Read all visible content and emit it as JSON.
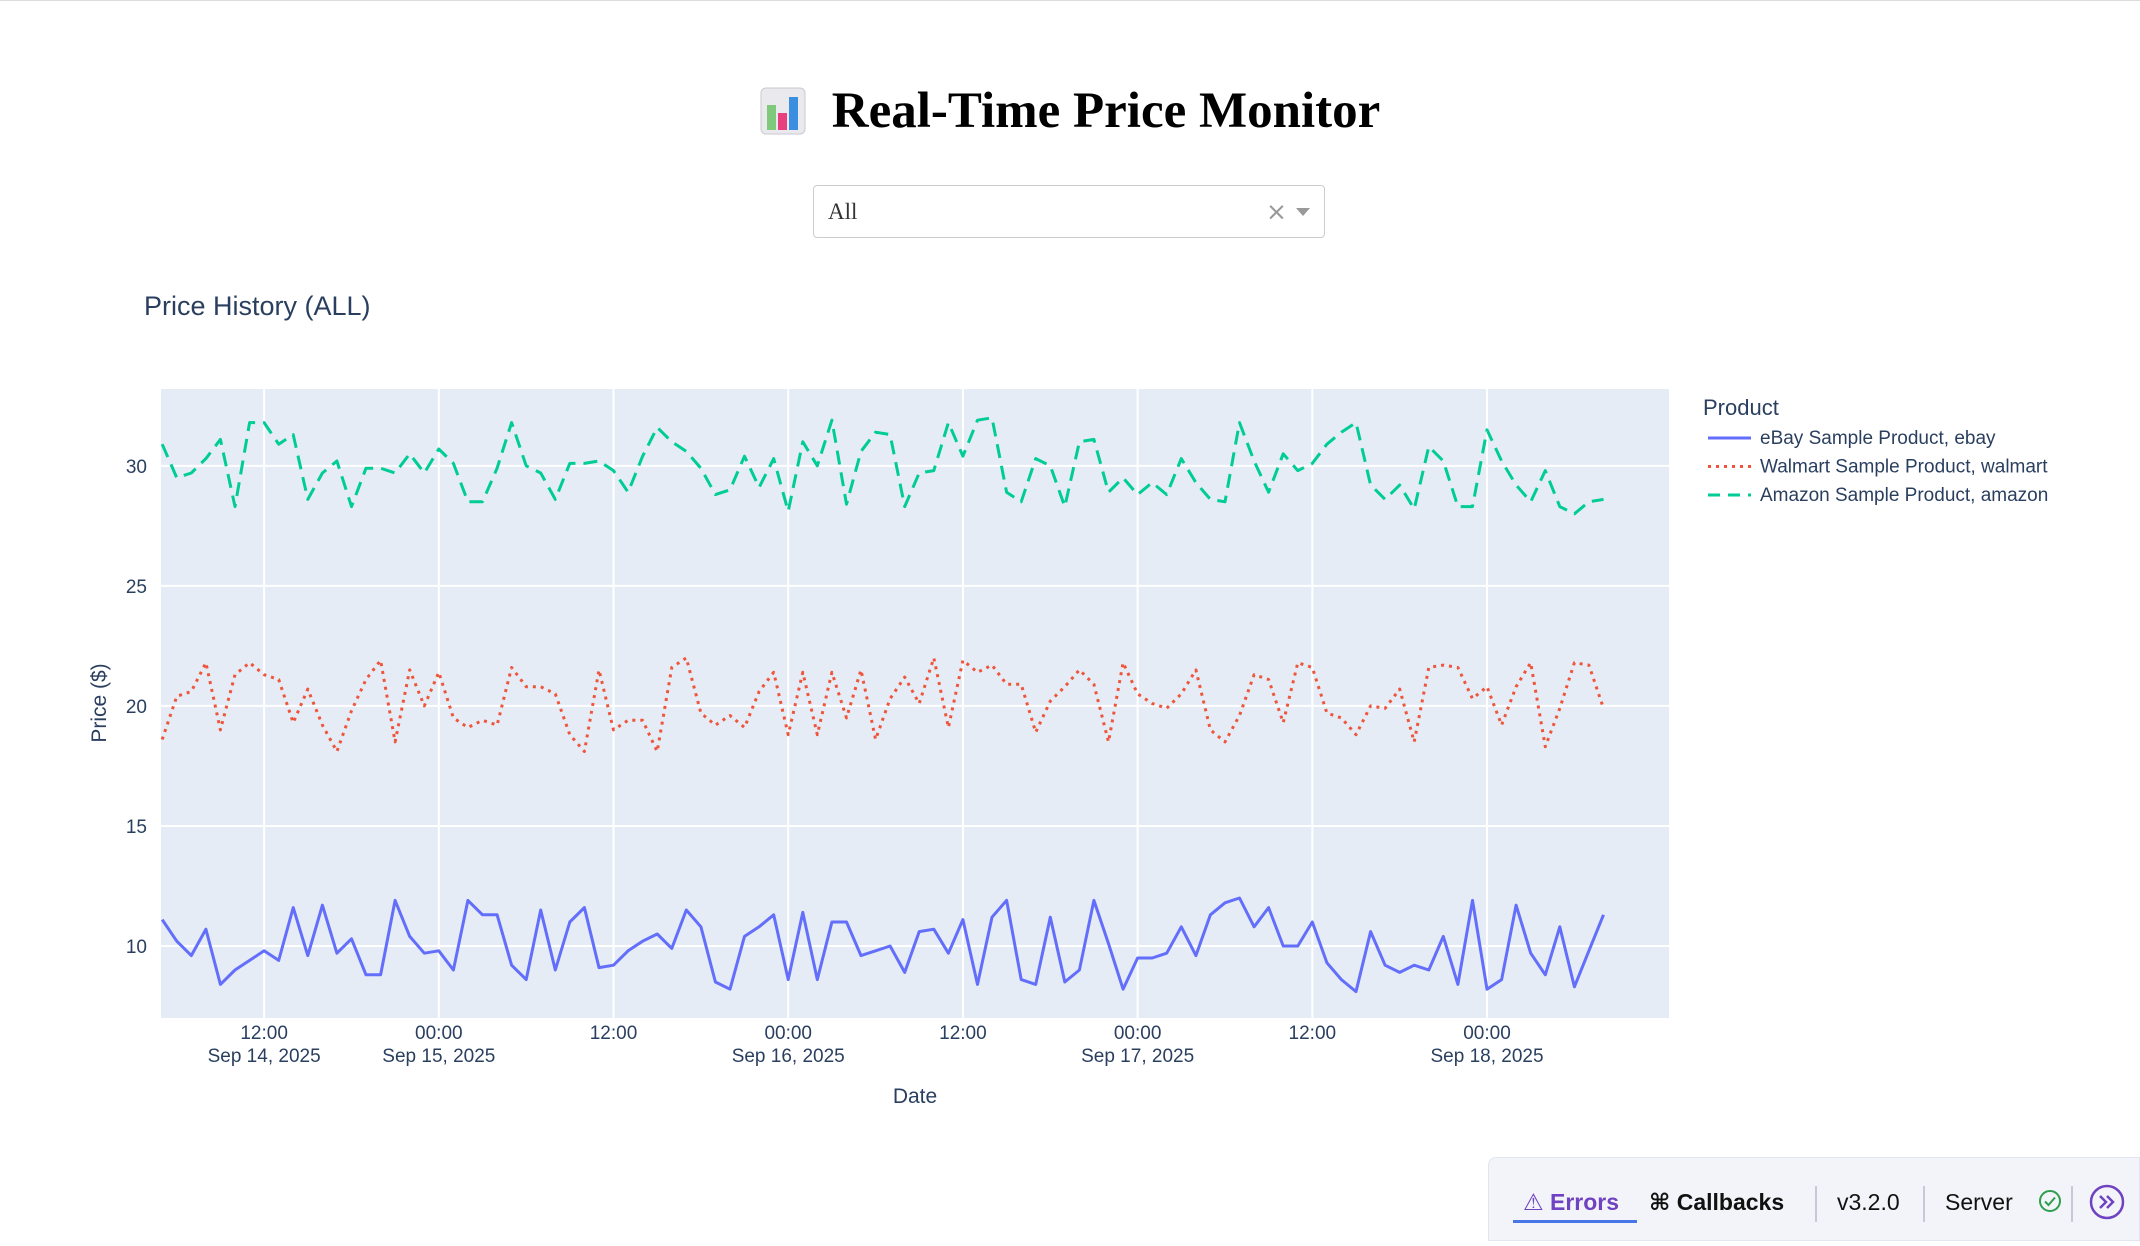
{
  "header": {
    "title": "Real-Time Price Monitor",
    "icon": "bar-chart-emoji-icon"
  },
  "filter": {
    "selected": "All",
    "clear_glyph": "×"
  },
  "devtools": {
    "errors_label": "Errors",
    "callbacks_label": "Callbacks",
    "version": "v3.2.0",
    "server_label": "Server",
    "accent": "#6f42c1"
  },
  "chart_data": {
    "type": "line",
    "title": "Price History (ALL)",
    "xlabel": "Date",
    "ylabel": "Price ($)",
    "legend_title": "Product",
    "legend_position": "right",
    "grid": true,
    "background": "#e5ecf6",
    "x_range": [
      "2025-09-14 04:55",
      "2025-09-18 12:30"
    ],
    "ylim": [
      7,
      33.2
    ],
    "yticks": [
      10,
      15,
      20,
      25,
      30
    ],
    "xticks": [
      {
        "at": "2025-09-14 12:00",
        "line1": "12:00",
        "line2": "Sep 14, 2025"
      },
      {
        "at": "2025-09-15 00:00",
        "line1": "00:00",
        "line2": "Sep 15, 2025"
      },
      {
        "at": "2025-09-15 12:00",
        "line1": "12:00",
        "line2": ""
      },
      {
        "at": "2025-09-16 00:00",
        "line1": "00:00",
        "line2": "Sep 16, 2025"
      },
      {
        "at": "2025-09-16 12:00",
        "line1": "12:00",
        "line2": ""
      },
      {
        "at": "2025-09-17 00:00",
        "line1": "00:00",
        "line2": "Sep 17, 2025"
      },
      {
        "at": "2025-09-17 12:00",
        "line1": "12:00",
        "line2": ""
      },
      {
        "at": "2025-09-18 00:00",
        "line1": "00:00",
        "line2": "Sep 18, 2025"
      }
    ],
    "x": [
      "2025-09-14 05:00",
      "2025-09-14 06:00",
      "2025-09-14 07:00",
      "2025-09-14 08:00",
      "2025-09-14 09:00",
      "2025-09-14 10:00",
      "2025-09-14 11:00",
      "2025-09-14 12:00",
      "2025-09-14 13:00",
      "2025-09-14 14:00",
      "2025-09-14 15:00",
      "2025-09-14 16:00",
      "2025-09-14 17:00",
      "2025-09-14 18:00",
      "2025-09-14 19:00",
      "2025-09-14 20:00",
      "2025-09-14 21:00",
      "2025-09-14 22:00",
      "2025-09-14 23:00",
      "2025-09-15 00:00",
      "2025-09-15 01:00",
      "2025-09-15 02:00",
      "2025-09-15 03:00",
      "2025-09-15 04:00",
      "2025-09-15 05:00",
      "2025-09-15 06:00",
      "2025-09-15 07:00",
      "2025-09-15 08:00",
      "2025-09-15 09:00",
      "2025-09-15 10:00",
      "2025-09-15 11:00",
      "2025-09-15 12:00",
      "2025-09-15 13:00",
      "2025-09-15 14:00",
      "2025-09-15 15:00",
      "2025-09-15 16:00",
      "2025-09-15 17:00",
      "2025-09-15 18:00",
      "2025-09-15 19:00",
      "2025-09-15 20:00",
      "2025-09-15 21:00",
      "2025-09-15 22:00",
      "2025-09-15 23:00",
      "2025-09-16 00:00",
      "2025-09-16 01:00",
      "2025-09-16 02:00",
      "2025-09-16 03:00",
      "2025-09-16 04:00",
      "2025-09-16 05:00",
      "2025-09-16 06:00",
      "2025-09-16 07:00",
      "2025-09-16 08:00",
      "2025-09-16 09:00",
      "2025-09-16 10:00",
      "2025-09-16 11:00",
      "2025-09-16 12:00",
      "2025-09-16 13:00",
      "2025-09-16 14:00",
      "2025-09-16 15:00",
      "2025-09-16 16:00",
      "2025-09-16 17:00",
      "2025-09-16 18:00",
      "2025-09-16 19:00",
      "2025-09-16 20:00",
      "2025-09-16 21:00",
      "2025-09-16 22:00",
      "2025-09-16 23:00",
      "2025-09-17 00:00",
      "2025-09-17 01:00",
      "2025-09-17 02:00",
      "2025-09-17 03:00",
      "2025-09-17 04:00",
      "2025-09-17 05:00",
      "2025-09-17 06:00",
      "2025-09-17 07:00",
      "2025-09-17 08:00",
      "2025-09-17 09:00",
      "2025-09-17 10:00",
      "2025-09-17 11:00",
      "2025-09-17 12:00",
      "2025-09-17 13:00",
      "2025-09-17 14:00",
      "2025-09-17 15:00",
      "2025-09-17 16:00",
      "2025-09-17 17:00",
      "2025-09-17 18:00",
      "2025-09-17 19:00",
      "2025-09-17 20:00",
      "2025-09-17 21:00",
      "2025-09-17 22:00",
      "2025-09-17 23:00",
      "2025-09-18 00:00",
      "2025-09-18 01:00",
      "2025-09-18 02:00",
      "2025-09-18 03:00",
      "2025-09-18 04:00",
      "2025-09-18 05:00",
      "2025-09-18 06:00",
      "2025-09-18 07:00",
      "2025-09-18 08:00"
    ],
    "series": [
      {
        "name": "eBay Sample Product, ebay",
        "color": "#636efa",
        "dash": "solid",
        "values": [
          11.1,
          10.2,
          9.6,
          10.7,
          8.4,
          9.0,
          9.4,
          9.8,
          9.4,
          11.6,
          9.6,
          11.7,
          9.7,
          10.3,
          8.8,
          8.8,
          11.9,
          10.4,
          9.7,
          9.8,
          9.0,
          11.9,
          11.3,
          11.3,
          9.2,
          8.6,
          11.5,
          9.0,
          11.0,
          11.6,
          9.1,
          9.2,
          9.8,
          10.2,
          10.5,
          9.9,
          11.5,
          10.8,
          8.5,
          8.2,
          10.4,
          10.8,
          11.3,
          8.6,
          11.4,
          8.6,
          11.0,
          11.0,
          9.6,
          9.8,
          10.0,
          8.9,
          10.6,
          10.7,
          9.7,
          11.1,
          8.4,
          11.2,
          11.9,
          8.6,
          8.4,
          11.2,
          8.5,
          9.0,
          11.9,
          10.1,
          8.2,
          9.5,
          9.5,
          9.7,
          10.8,
          9.6,
          11.3,
          11.8,
          12.0,
          10.8,
          11.6,
          10.0,
          10.0,
          11.0,
          9.3,
          8.6,
          8.1,
          10.6,
          9.2,
          8.9,
          9.2,
          9.0,
          10.4,
          8.4,
          11.9,
          8.2,
          8.6,
          11.7,
          9.7,
          8.8,
          10.8,
          8.3,
          9.8,
          11.3
        ]
      },
      {
        "name": "Walmart Sample Product, walmart",
        "color": "#ef553b",
        "dash": "dot",
        "values": [
          18.6,
          20.4,
          20.6,
          21.8,
          19.0,
          21.3,
          21.8,
          21.3,
          21.1,
          19.3,
          20.7,
          19.2,
          18.1,
          19.8,
          21.1,
          21.9,
          18.5,
          21.5,
          20.0,
          21.4,
          19.5,
          19.1,
          19.4,
          19.2,
          21.6,
          20.8,
          20.8,
          20.5,
          18.8,
          18.1,
          21.5,
          19.0,
          19.4,
          19.4,
          18.1,
          21.6,
          22.0,
          19.7,
          19.2,
          19.6,
          19.1,
          20.6,
          21.4,
          18.8,
          21.4,
          18.8,
          21.4,
          19.5,
          21.5,
          18.6,
          20.3,
          21.2,
          20.1,
          22.0,
          19.1,
          21.9,
          21.4,
          21.7,
          20.9,
          20.9,
          18.9,
          20.2,
          20.8,
          21.5,
          20.9,
          18.5,
          21.8,
          20.5,
          20.1,
          19.9,
          20.5,
          21.5,
          19.0,
          18.5,
          19.6,
          21.3,
          21.1,
          19.3,
          21.8,
          21.6,
          19.7,
          19.5,
          18.8,
          20.0,
          19.9,
          20.7,
          18.5,
          21.6,
          21.7,
          21.6,
          20.3,
          20.8,
          19.2,
          20.8,
          21.8,
          18.3,
          19.9,
          21.8,
          21.7,
          19.9
        ]
      },
      {
        "name": "Amazon Sample Product, amazon",
        "color": "#00cc96",
        "dash": "dash",
        "values": [
          30.9,
          29.5,
          29.7,
          30.3,
          31.1,
          28.3,
          31.8,
          31.8,
          30.9,
          31.3,
          28.6,
          29.7,
          30.2,
          28.3,
          29.9,
          29.9,
          29.7,
          30.5,
          29.7,
          30.7,
          30.1,
          28.5,
          28.5,
          29.9,
          31.8,
          30.0,
          29.7,
          28.6,
          30.1,
          30.1,
          30.2,
          29.8,
          28.9,
          30.4,
          31.6,
          31.0,
          30.6,
          29.9,
          28.8,
          29.0,
          30.4,
          29.1,
          30.3,
          28.1,
          31.0,
          30.0,
          31.9,
          28.4,
          30.6,
          31.4,
          31.3,
          28.3,
          29.7,
          29.8,
          31.8,
          30.4,
          31.9,
          32.0,
          28.9,
          28.5,
          30.3,
          30.0,
          28.3,
          31.0,
          31.1,
          28.9,
          29.5,
          28.8,
          29.3,
          28.8,
          30.3,
          29.3,
          28.6,
          28.5,
          31.8,
          30.2,
          28.9,
          30.5,
          29.8,
          30.1,
          30.9,
          31.4,
          31.8,
          29.2,
          28.6,
          29.2,
          28.2,
          30.8,
          30.2,
          28.3,
          28.3,
          31.5,
          30.2,
          29.2,
          28.5,
          29.8,
          28.3,
          28.0,
          28.5,
          28.6
        ]
      }
    ]
  }
}
